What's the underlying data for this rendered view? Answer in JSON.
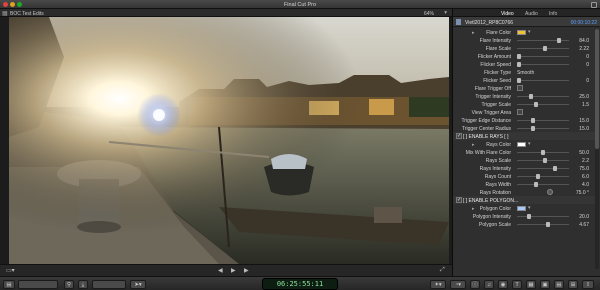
{
  "window": {
    "title": "Final Cut Pro"
  },
  "viewer": {
    "event_label": "BOC Test Edits",
    "zoom": "64%"
  },
  "inspector": {
    "tabs": [
      "Video",
      "Audio",
      "Info"
    ],
    "active_tab": "Video",
    "clip_name": "Vietl2012_RP8C0766",
    "clip_duration": "00:00:10:22",
    "rows": [
      {
        "type": "color",
        "label": "Flare Color",
        "color": "#f2c230"
      },
      {
        "type": "slider",
        "label": "Flare Intensity",
        "value": "84.0",
        "level": 0.84
      },
      {
        "type": "slider",
        "label": "Flare Scale",
        "value": "2.22",
        "level": 0.55
      },
      {
        "type": "slider",
        "label": "Flicker Amount",
        "value": "0",
        "level": 0.0
      },
      {
        "type": "slider",
        "label": "Flicker Speed",
        "value": "0",
        "level": 0.0
      },
      {
        "type": "popup",
        "label": "Flicker Type",
        "value": "Smooth"
      },
      {
        "type": "slider",
        "label": "Flicker Seed",
        "value": "0",
        "level": 0.0
      },
      {
        "type": "check",
        "label": "Flare Trigger Off",
        "checked": false
      },
      {
        "type": "slider",
        "label": "Trigger Intensity",
        "value": "25.0",
        "level": 0.25
      },
      {
        "type": "slider",
        "label": "Trigger Scale",
        "value": "1.5",
        "level": 0.35
      },
      {
        "type": "check",
        "label": "View Trigger Area",
        "checked": false
      },
      {
        "type": "slider",
        "label": "Trigger Edge Distance",
        "value": "15.0",
        "level": 0.3
      },
      {
        "type": "slider",
        "label": "Trigger Center Radius",
        "value": "15.0",
        "level": 0.3
      },
      {
        "type": "section",
        "label": "[ ] ENABLE RAYS [ ]",
        "checked": true
      },
      {
        "type": "color",
        "label": "Rays Color",
        "color": "#ffffff"
      },
      {
        "type": "slider",
        "label": "Mix With Flare Color",
        "value": "50.0",
        "level": 0.5
      },
      {
        "type": "slider",
        "label": "Rays Scale",
        "value": "2.2",
        "level": 0.55
      },
      {
        "type": "slider",
        "label": "Rays Intensity",
        "value": "75.0",
        "level": 0.75
      },
      {
        "type": "slider",
        "label": "Rays Count",
        "value": "6.0",
        "level": 0.4
      },
      {
        "type": "slider",
        "label": "Rays Width",
        "value": "4.0",
        "level": 0.35
      },
      {
        "type": "dial",
        "label": "Rays Rotation",
        "value": "75.0 °"
      },
      {
        "type": "section",
        "label": "[ ] ENABLE POLYGON...",
        "checked": true
      },
      {
        "type": "color",
        "label": "Polygon Color",
        "color": "#a8c8ff"
      },
      {
        "type": "slider",
        "label": "Polygon Intensity",
        "value": "20.0",
        "level": 0.2
      },
      {
        "type": "slider",
        "label": "Polygon Scale",
        "value": "4.67",
        "level": 0.6
      }
    ]
  },
  "toolbar": {
    "timecode": "06:25:55:11"
  }
}
